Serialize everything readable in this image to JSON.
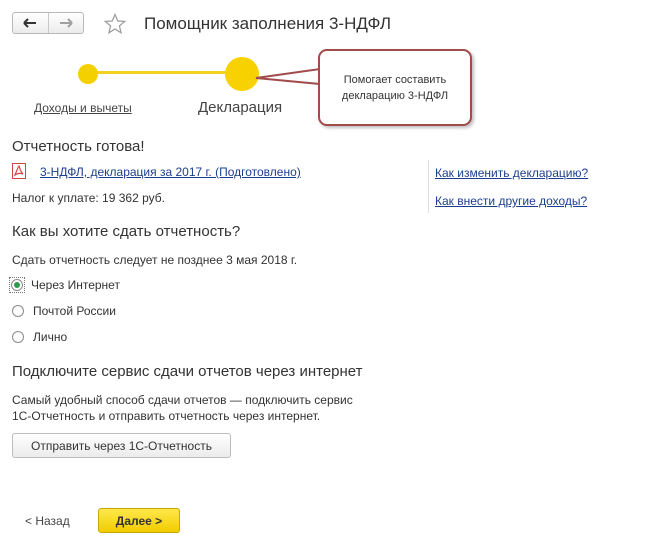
{
  "header": {
    "title": "Помощник заполнения 3-НДФЛ",
    "back_icon": "arrow-left-icon",
    "forward_icon": "arrow-right-icon",
    "favorite_icon": "star-icon"
  },
  "stepper": {
    "steps": [
      {
        "label": "Доходы и вычеты",
        "state": "link"
      },
      {
        "label": "Декларация",
        "state": "current"
      }
    ],
    "accent_color": "#f5d000"
  },
  "tooltip": {
    "text": "Помогает составить декларацию 3-НДФЛ",
    "border_color": "#a24b4b"
  },
  "report": {
    "heading": "Отчетность готова!",
    "document_link": "3-НДФЛ, декларация за 2017 г. (Подготовлено)",
    "tax_label": "Налог к уплате: 19 362 руб."
  },
  "side_links": [
    "Как изменить декларацию?",
    "Как внести другие доходы?"
  ],
  "submit": {
    "heading": "Как вы хотите сдать отчетность?",
    "deadline": "Сдать отчетность следует не позднее 3 мая 2018 г.",
    "options": [
      {
        "label": "Через Интернет",
        "selected": true
      },
      {
        "label": "Почтой России",
        "selected": false
      },
      {
        "label": "Лично",
        "selected": false
      }
    ]
  },
  "service": {
    "heading": "Подключите сервис сдачи отчетов через интернет",
    "description_line1": "Самый удобный способ сдачи отчетов — подключить сервис",
    "description_line2": "1С-Отчетность и отправить отчетность через интернет.",
    "button_label": "Отправить через 1С-Отчетность"
  },
  "footer": {
    "back_label": "< Назад",
    "next_label": "Далее >"
  }
}
